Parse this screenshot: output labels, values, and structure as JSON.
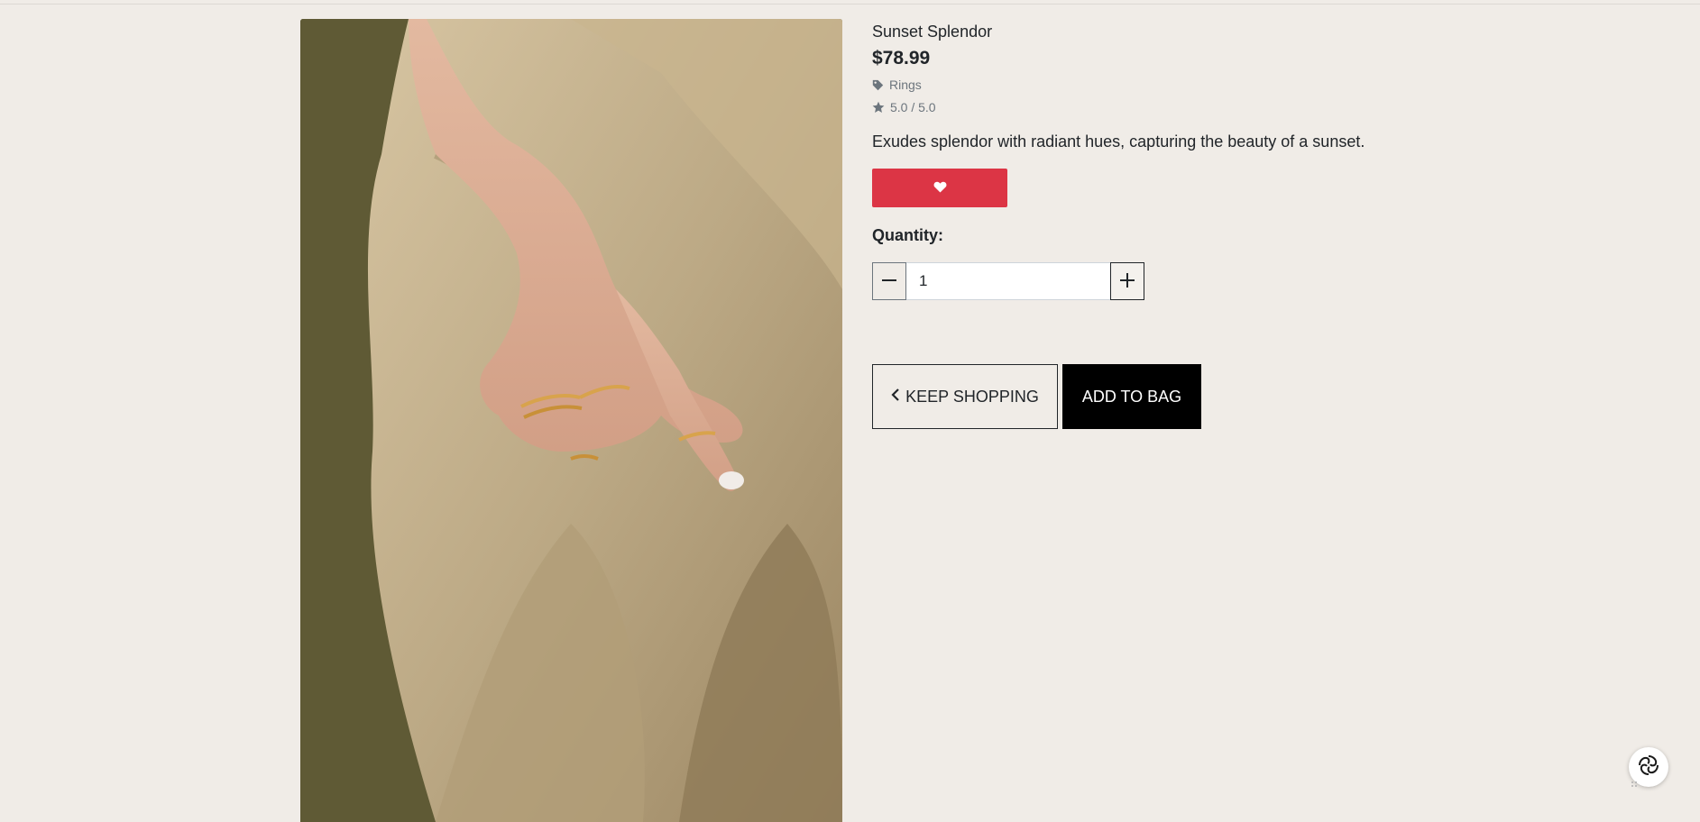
{
  "product": {
    "name": "Sunset Splendor",
    "price": "$78.99",
    "category": "Rings",
    "rating": "5.0 / 5.0",
    "description": "Exudes splendor with radiant hues, capturing the beauty of a sunset."
  },
  "icons": {
    "category": "tag-icon",
    "rating": "star-icon",
    "favorite": "heart-icon",
    "decrease": "minus-icon",
    "increase": "plus-icon",
    "back": "chevron-left-icon",
    "assistant": "swirl-icon"
  },
  "quantity": {
    "label": "Quantity:",
    "value": "1"
  },
  "actions": {
    "keep_shopping": "KEEP SHOPPING",
    "add_to_bag": "ADD TO BAG"
  },
  "colors": {
    "background": "#f0ece7",
    "favorite_button": "#dc3545",
    "primary_button": "#000000"
  }
}
